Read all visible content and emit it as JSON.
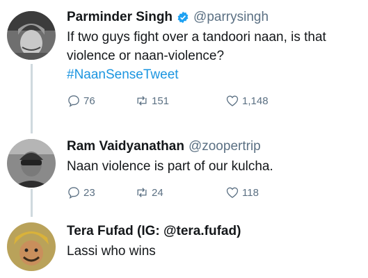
{
  "tweets": [
    {
      "name": "Parminder Singh",
      "handle": "@parrysingh",
      "verified": true,
      "text": "If two guys fight over a tandoori naan, is that violence or naan-violence?",
      "hashtag": "#NaanSenseTweet",
      "replies": "76",
      "retweets": "151",
      "likes": "1,148"
    },
    {
      "name": "Ram Vaidyanathan",
      "handle": "@zoopertrip",
      "verified": false,
      "text": "Naan violence is part of our kulcha.",
      "replies": "23",
      "retweets": "24",
      "likes": "118"
    },
    {
      "name": "Tera Fufad (IG: @tera.fufad)",
      "text": "Lassi who wins"
    }
  ],
  "colors": {
    "accent": "#1b95e0",
    "muted": "#5b7083",
    "verified": "#1da1f2"
  },
  "icons": {
    "reply": "reply-icon",
    "retweet": "retweet-icon",
    "like": "heart-icon",
    "verified": "verified-badge-icon"
  }
}
